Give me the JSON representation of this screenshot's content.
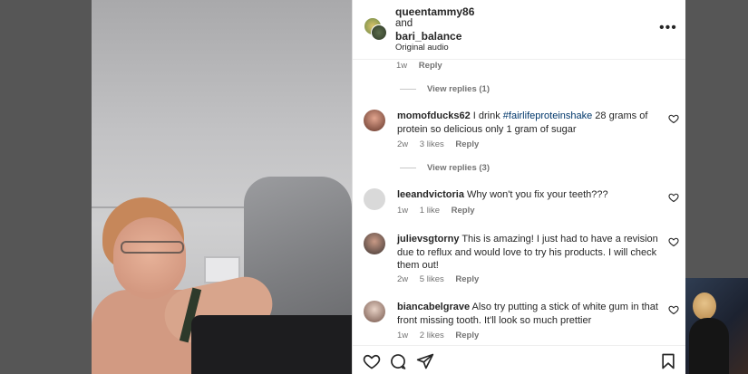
{
  "header": {
    "username_primary": "queentammy86",
    "joiner": "and",
    "username_secondary": "bari_balance",
    "audio_label": "Original audio",
    "more_label": "•••"
  },
  "prev_comment_meta": {
    "time": "1w",
    "reply": "Reply"
  },
  "view_replies": [
    {
      "label": "View replies (1)"
    },
    {
      "label": "View replies (3)"
    }
  ],
  "comments": [
    {
      "username": "momofducks62",
      "text_before": "I drink ",
      "hashtag": "#fairlifeproteinshake",
      "text_after": " 28 grams of protein so delicious only 1 gram of sugar",
      "time": "2w",
      "likes": "3 likes",
      "reply": "Reply"
    },
    {
      "username": "leeandvictoria",
      "text": "Why won't you fix your teeth???",
      "time": "1w",
      "likes": "1 like",
      "reply": "Reply"
    },
    {
      "username": "julievsgtorny",
      "text": "This is amazing! I just had to have a revision due to reflux and would love to try his products. I will check them out!",
      "time": "2w",
      "likes": "5 likes",
      "reply": "Reply"
    },
    {
      "username": "biancabelgrave",
      "text": "Also try putting a stick of white gum in that front missing tooth. It'll look so much prettier",
      "time": "1w",
      "likes": "2 likes",
      "reply": "Reply"
    }
  ],
  "icons": {
    "like": "heart-icon",
    "comment": "comment-icon",
    "share": "send-icon",
    "save": "bookmark-icon"
  },
  "colors": {
    "text": "#262626",
    "secondary": "#737373",
    "hashtag": "#00376b"
  }
}
